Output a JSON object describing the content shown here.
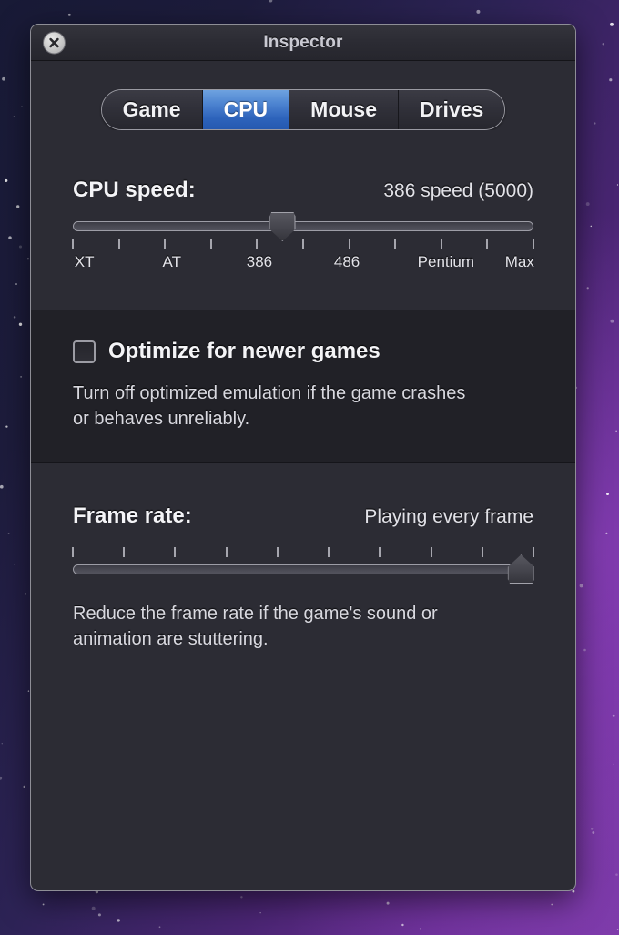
{
  "desktop": {
    "background_colors": [
      "#181a36",
      "#2d2356",
      "#7b3aa5"
    ]
  },
  "window": {
    "title": "Inspector",
    "close_icon": "close-x-icon",
    "accent_color": "#2d63bb"
  },
  "tabs": [
    {
      "label": "Game",
      "active": false
    },
    {
      "label": "CPU",
      "active": true
    },
    {
      "label": "Mouse",
      "active": false
    },
    {
      "label": "Drives",
      "active": false
    }
  ],
  "cpu_section": {
    "label": "CPU speed:",
    "value": "386 speed (5000)",
    "slider": {
      "thumb_percent": 45.5,
      "tick_count": 11,
      "tick_labels": [
        "XT",
        "AT",
        "386",
        "486",
        "Pentium",
        "Max"
      ],
      "tick_label_positions": [
        2.5,
        21.5,
        40.5,
        59.5,
        81.0,
        97.0
      ]
    }
  },
  "optimize_section": {
    "checkbox_label": "Optimize for newer games",
    "checked": false,
    "description": "Turn off optimized emulation if the game crashes or behaves unreliably."
  },
  "framerate_section": {
    "label": "Frame rate:",
    "value": "Playing every frame",
    "slider": {
      "thumb_percent": 97.5,
      "tick_count": 10
    },
    "description": "Reduce the frame rate if the game's sound or animation are stuttering."
  }
}
